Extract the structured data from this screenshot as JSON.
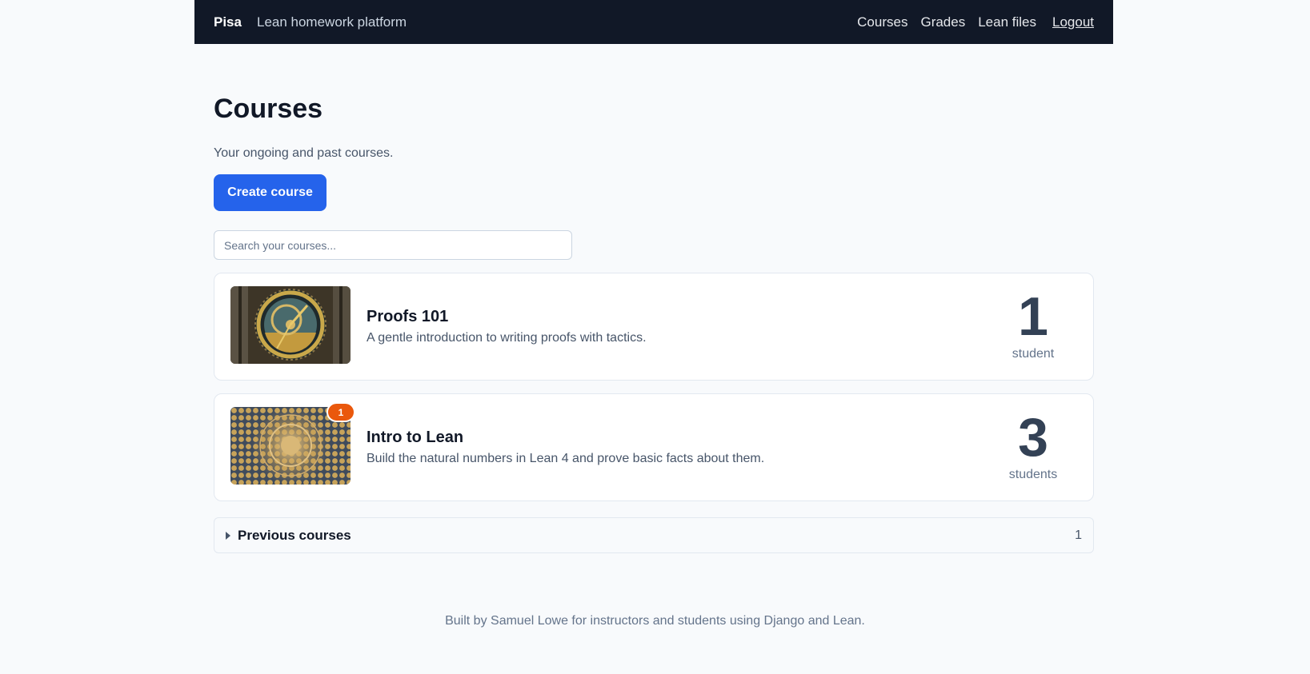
{
  "header": {
    "brand": "Pisa",
    "tagline": "Lean homework platform",
    "nav": [
      "Courses",
      "Grades",
      "Lean files"
    ],
    "logout": "Logout"
  },
  "page": {
    "title": "Courses",
    "subtitle": "Your ongoing and past courses.",
    "create_button": "Create course",
    "search_placeholder": "Search your courses..."
  },
  "courses": [
    {
      "title": "Proofs 101",
      "description": "A gentle introduction to writing proofs with tactics.",
      "count": "1",
      "count_label": "student",
      "image": "astronomical-clock-image"
    },
    {
      "title": "Intro to Lean",
      "description": "Build the natural numbers in Lean 4 and prove basic facts about them.",
      "count": "3",
      "count_label": "students",
      "badge": "1",
      "image": "mosaic-dome-image"
    }
  ],
  "previous": {
    "label": "Previous courses",
    "count": "1"
  },
  "footer": {
    "text": "Built by Samuel Lowe for instructors and students using Django and Lean."
  },
  "colors": {
    "header_bg": "#111827",
    "primary": "#2563eb",
    "badge": "#ea580c"
  }
}
